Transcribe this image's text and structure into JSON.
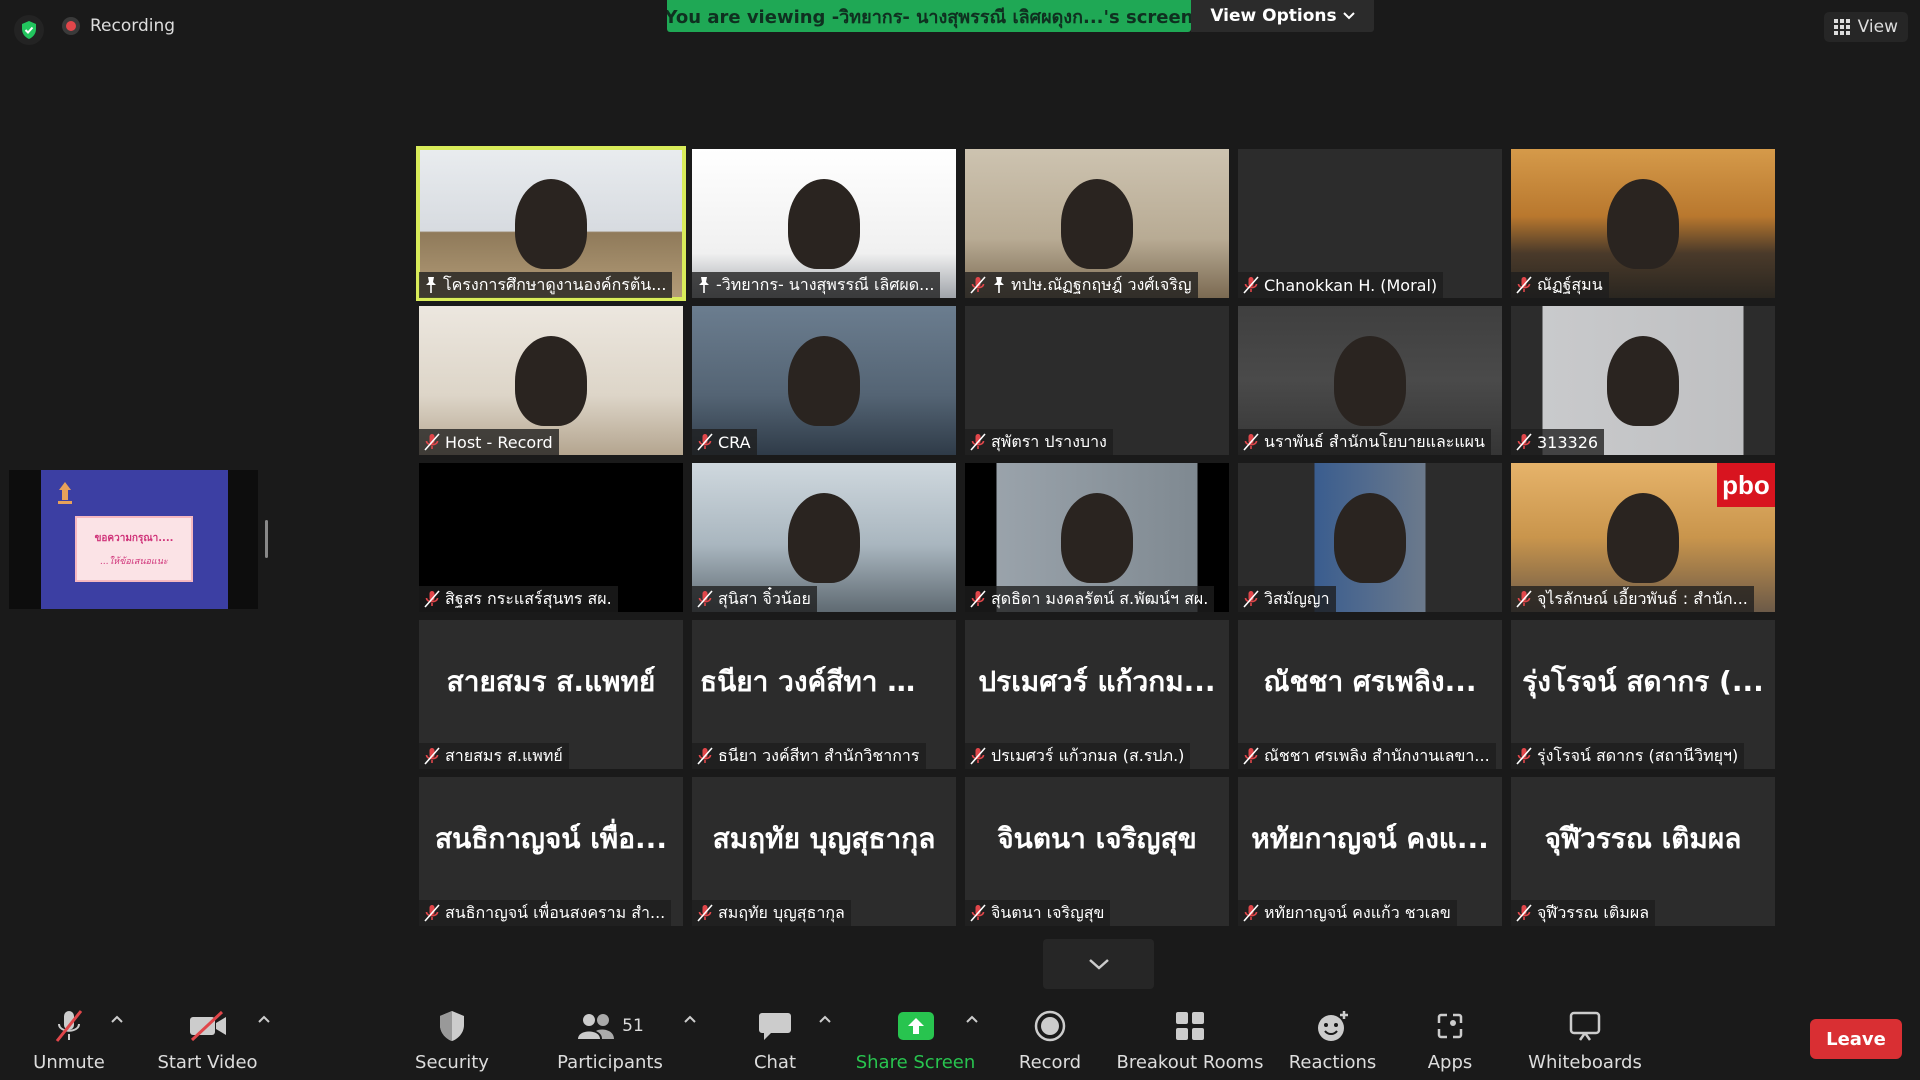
{
  "top": {
    "recording_label": "Recording",
    "banner_text": "You are viewing -วิทยากร- นางสุพรรณี เลิศผดุงก...'s screen",
    "view_options_label": "View Options",
    "view_label": "View"
  },
  "share_slide": {
    "line1": "ขอความกรุณา....",
    "line2": "...ให้ข้อเสนอแนะ"
  },
  "tiles": [
    {
      "name": "โครงการศึกษาดูงานองค์กรต้น...",
      "big": "",
      "muted": false,
      "pinned": true,
      "active": true,
      "style": "v-a"
    },
    {
      "name": "-วิทยากร- นางสุพรรณี เลิศผด...",
      "big": "",
      "muted": false,
      "pinned": true,
      "active": false,
      "style": "v-b"
    },
    {
      "name": "ทปษ.ณัฏฐกฤษฎ์ วงศ์เจริญ",
      "big": "",
      "muted": true,
      "pinned": true,
      "active": false,
      "style": "v-c"
    },
    {
      "name": "Chanokkan H. (Moral)",
      "big": "",
      "muted": true,
      "pinned": false,
      "active": false,
      "style": "v-d"
    },
    {
      "name": "ณัฏฐ์สุมน",
      "big": "",
      "muted": true,
      "pinned": false,
      "active": false,
      "style": "v-e"
    },
    {
      "name": "Host - Record",
      "big": "",
      "muted": true,
      "pinned": false,
      "active": false,
      "style": "v-f"
    },
    {
      "name": "CRA",
      "big": "",
      "muted": true,
      "pinned": false,
      "active": false,
      "style": "v-g"
    },
    {
      "name": "สุพัตรา ปรางบาง",
      "big": "",
      "muted": true,
      "pinned": false,
      "active": false,
      "style": "v-h"
    },
    {
      "name": "นราพันธ์ สำนักนโยบายและแผน",
      "big": "",
      "muted": true,
      "pinned": false,
      "active": false,
      "style": "v-i"
    },
    {
      "name": "313326",
      "big": "",
      "muted": true,
      "pinned": false,
      "active": false,
      "style": "v-j"
    },
    {
      "name": "สิฐสร กระแสร์สุนทร สผ.",
      "big": "",
      "muted": true,
      "pinned": false,
      "active": false,
      "style": "v-k"
    },
    {
      "name": "สุนิสา จิ๋วน้อย",
      "big": "",
      "muted": true,
      "pinned": false,
      "active": false,
      "style": "v-l"
    },
    {
      "name": "สุดธิดา มงคลรัตน์ ส.พัฒน์ฯ สผ.",
      "big": "",
      "muted": true,
      "pinned": false,
      "active": false,
      "style": "v-m"
    },
    {
      "name": "วิสมัญญา",
      "big": "",
      "muted": true,
      "pinned": false,
      "active": false,
      "style": "v-n"
    },
    {
      "name": "จุไรลักษณ์ เอี้ยวพันธ์ : สำนัก...",
      "big": "",
      "muted": true,
      "pinned": false,
      "active": false,
      "style": "v-o",
      "pbo": "pbo"
    },
    {
      "name": "สายสมร ส.แพทย์",
      "big": "สายสมร ส.แพทย์",
      "muted": true,
      "pinned": false,
      "active": false,
      "style": ""
    },
    {
      "name": "ธนียา วงค์สีทา สำนักวิชาการ",
      "big": "ธนียา วงค์สีทา สำ...",
      "muted": true,
      "pinned": false,
      "active": false,
      "style": ""
    },
    {
      "name": "ปรเมศวร์ แก้วกมล (ส.รปภ.)",
      "big": "ปรเมศวร์ แก้วกม...",
      "muted": true,
      "pinned": false,
      "active": false,
      "style": ""
    },
    {
      "name": "ณัชชา ศรเพลิง สำนักงานเลขา...",
      "big": "ณัชชา ศรเพลิง...",
      "muted": true,
      "pinned": false,
      "active": false,
      "style": ""
    },
    {
      "name": "รุ่งโรจน์ สดากร (สถานีวิทยุฯ)",
      "big": "รุ่งโรจน์ สดากร (...",
      "muted": true,
      "pinned": false,
      "active": false,
      "style": ""
    },
    {
      "name": "สนธิกาญจน์ เพื่อนสงคราม สำ...",
      "big": "สนธิกาญจน์ เพื่อ...",
      "muted": true,
      "pinned": false,
      "active": false,
      "style": ""
    },
    {
      "name": "สมฤทัย บุญสุธากุล",
      "big": "สมฤทัย บุญสุธากุล",
      "muted": true,
      "pinned": false,
      "active": false,
      "style": ""
    },
    {
      "name": "จินตนา เจริญสุข",
      "big": "จินตนา เจริญสุข",
      "muted": true,
      "pinned": false,
      "active": false,
      "style": ""
    },
    {
      "name": "หทัยกาญจน์ คงแก้ว ชวเลข",
      "big": "หทัยกาญจน์ คงแ...",
      "muted": true,
      "pinned": false,
      "active": false,
      "style": ""
    },
    {
      "name": "จุฬีวรรณ เติมผล",
      "big": "จุฬีวรรณ เติมผล",
      "muted": true,
      "pinned": false,
      "active": false,
      "style": ""
    }
  ],
  "toolbar": {
    "unmute": "Unmute",
    "start_video": "Start Video",
    "security": "Security",
    "participants": "Participants",
    "participants_count": "51",
    "chat": "Chat",
    "share_screen": "Share Screen",
    "record": "Record",
    "breakout": "Breakout Rooms",
    "reactions": "Reactions",
    "apps": "Apps",
    "whiteboards": "Whiteboards",
    "leave": "Leave"
  },
  "colors": {
    "banner_green": "#1fa855",
    "active_speaker": "#d9ec5a",
    "share_green": "#28c44f",
    "leave_red": "#d92f33",
    "muted_red": "#e0464a"
  }
}
